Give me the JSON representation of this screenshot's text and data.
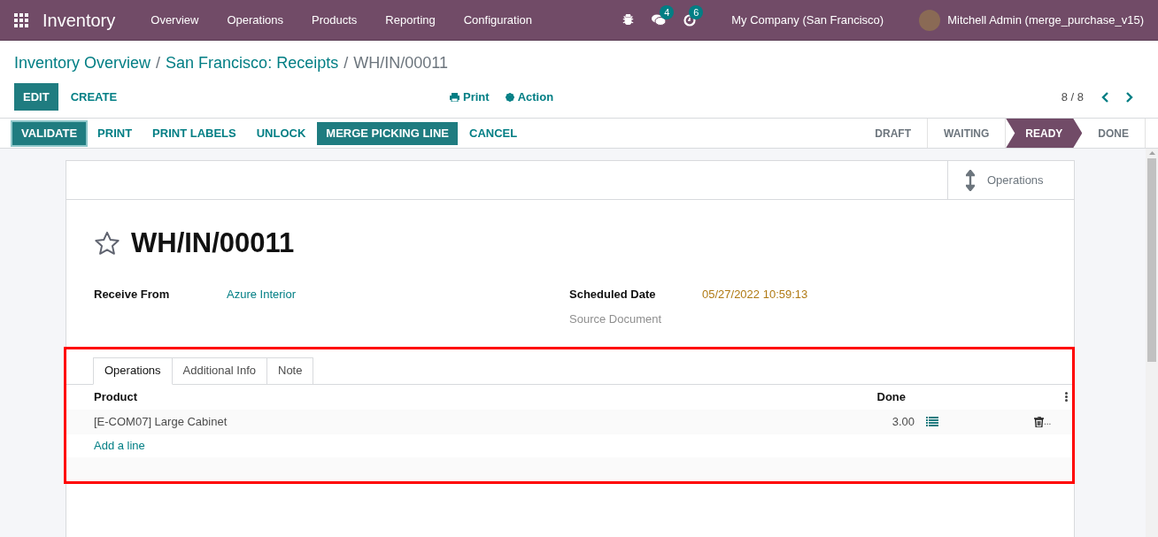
{
  "navbar": {
    "app_name": "Inventory",
    "menu": [
      "Overview",
      "Operations",
      "Products",
      "Reporting",
      "Configuration"
    ],
    "messages_count": "4",
    "activities_count": "6",
    "company": "My Company (San Francisco)",
    "user": "Mitchell Admin (merge_purchase_v15)"
  },
  "breadcrumb": [
    {
      "label": "Inventory Overview",
      "link": true
    },
    {
      "separator": "/",
      "label": "San Francisco: Receipts",
      "link": true
    },
    {
      "separator": "/",
      "label": "WH/IN/00011",
      "link": false
    }
  ],
  "control_panel": {
    "buttons": [
      {
        "label": "EDIT",
        "kind": "primary"
      },
      {
        "label": "CREATE",
        "kind": "link"
      }
    ],
    "print": "Print",
    "action": "Action",
    "pager": "8 / 8"
  },
  "header_buttons": [
    {
      "label": "VALIDATE",
      "kind": "primary",
      "focused": true
    },
    {
      "label": "PRINT",
      "kind": "link",
      "focused": false
    },
    {
      "label": "PRINT LABELS",
      "kind": "link",
      "focused": false
    },
    {
      "label": "UNLOCK",
      "kind": "link",
      "focused": false
    },
    {
      "label": "MERGE PICKING LINE",
      "kind": "primary",
      "focused": false
    },
    {
      "label": "CANCEL",
      "kind": "link",
      "focused": false
    }
  ],
  "stages": [
    {
      "label": "DRAFT",
      "selected": false
    },
    {
      "label": "WAITING",
      "selected": false
    },
    {
      "label": "READY",
      "selected": true
    },
    {
      "label": "DONE",
      "selected": false
    }
  ],
  "smart_button": "Operations",
  "record": {
    "favorite": false,
    "title": "WH/IN/00011"
  },
  "fields_left": [
    {
      "label": "Receive From",
      "value": "Azure Interior",
      "kind": "link"
    }
  ],
  "fields_right": [
    {
      "label": "Scheduled Date",
      "value": "05/27/2022 10:59:13",
      "kind": "date"
    },
    {
      "label": "Source Document",
      "kind": "empty"
    }
  ],
  "tabs": [
    {
      "label": "Operations",
      "selected": true
    },
    {
      "label": "Additional Info",
      "selected": false
    },
    {
      "label": "Note",
      "selected": false
    }
  ],
  "table": {
    "columns": [
      "Product",
      "Done"
    ],
    "rows": [
      {
        "product": "[E-COM07] Large Cabinet",
        "done": "3.00",
        "trash_suffix": "..."
      }
    ],
    "add_line": "Add a line"
  }
}
